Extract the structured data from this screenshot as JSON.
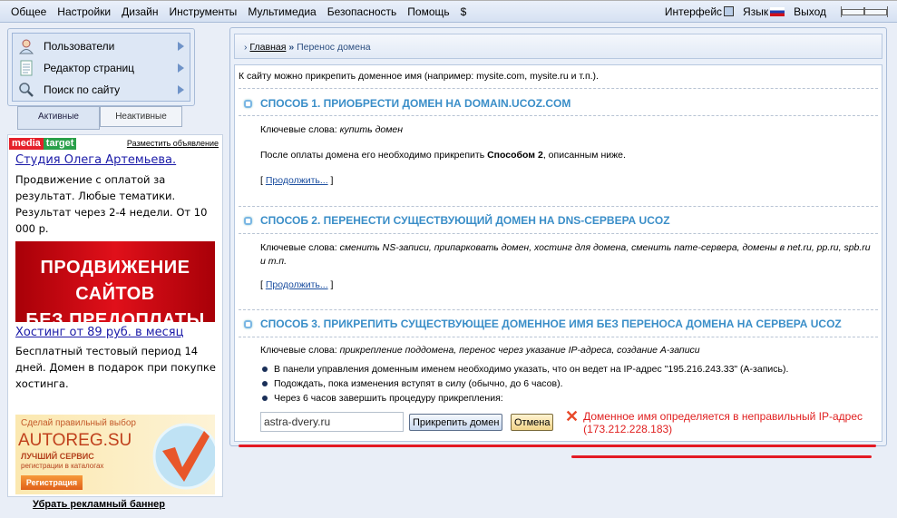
{
  "topbar": {
    "menu": [
      "Общее",
      "Настройки",
      "Дизайн",
      "Инструменты",
      "Мультимедиа",
      "Безопасность",
      "Помощь",
      "$"
    ],
    "interface": "Интерфейс",
    "language": "Язык",
    "logout": "Выход"
  },
  "sidebar": {
    "items": [
      {
        "label": "Пользователи",
        "icon": "user-icon"
      },
      {
        "label": "Редактор страниц",
        "icon": "page-icon"
      },
      {
        "label": "Поиск по сайту",
        "icon": "search-icon"
      }
    ],
    "tabs": [
      "Активные",
      "Неактивные"
    ]
  },
  "ad": {
    "brand_media": "media",
    "brand_target": "target",
    "place_ad": "Разместить объявление",
    "ad1_title": "Студия Олега Артемьева.",
    "ad1_text": "Продвижение с оплатой за результат. Любые тематики. Результат через 2-4 недели. От 10 000 р.",
    "banner1_line1": "ПРОДВИЖЕНИЕ САЙТОВ",
    "banner1_line2": "БЕЗ ПРЕДОПЛАТЫ",
    "ad2_title": "Хостинг от 89 руб. в месяц",
    "ad2_text": "Бесплатный тестовый период 14 дней. Домен в подарок при покупке хостинга.",
    "banner2_tagline": "Сделай правильный выбор",
    "banner2_brand": "AUTOREG.SU",
    "banner2_sub1": "ЛУЧШИЙ СЕРВИС",
    "banner2_sub2": "регистрации в каталогах",
    "banner2_button": "Регистрация",
    "remove_banner": "Убрать рекламный баннер"
  },
  "breadcrumb": {
    "home": "Главная",
    "sep": "»",
    "current": "Перенос домена"
  },
  "main": {
    "intro": "К сайту можно прикрепить доменное имя (например: mysite.com, mysite.ru и т.п.).",
    "kw_label": "Ключевые слова:",
    "s1": {
      "title": "СПОСОБ 1. ПРИОБРЕСТИ ДОМЕН НА DOMAIN.UCOZ.COM",
      "keywords": "купить домен",
      "text_before": "После оплаты домена его необходимо прикрепить ",
      "text_bold": "Способом 2",
      "text_after": ", описанным ниже.",
      "more": "Продолжить..."
    },
    "s2": {
      "title": "СПОСОБ 2. ПЕРЕНЕСТИ СУЩЕСТВУЮЩИЙ ДОМЕН НА DNS-СЕРВЕРА UCOZ",
      "keywords": "сменить NS-записи, припарковать домен, хостинг для домена, сменить name-сервера, домены в net.ru, pp.ru, spb.ru и т.п.",
      "more": "Продолжить..."
    },
    "s3": {
      "title": "СПОСОБ 3. ПРИКРЕПИТЬ СУЩЕСТВУЮЩЕЕ ДОМЕННОЕ ИМЯ БЕЗ ПЕРЕНОСА ДОМЕНА НА СЕРВЕРА UCOZ",
      "keywords": "прикрепление поддомена, перенос через указание IP-адреса, создание A-записи",
      "steps": [
        "В панели управления доменным именем необходимо указать, что он ведет на IP-адрес \"195.216.243.33\" (A-запись).",
        "Подождать, пока изменения вступят в силу (обычно, до 6 часов).",
        "Через 6 часов завершить процедуру прикрепления:"
      ],
      "domain_value": "astra-dvery.ru",
      "attach_button": "Прикрепить домен",
      "cancel_button": "Отмена",
      "error_line1": "Доменное имя определяется в неправильный IP-адрес",
      "error_line2": "(173.212.228.183)"
    }
  },
  "colors": {
    "accent": "#3a8ec8",
    "error": "#e02020"
  }
}
